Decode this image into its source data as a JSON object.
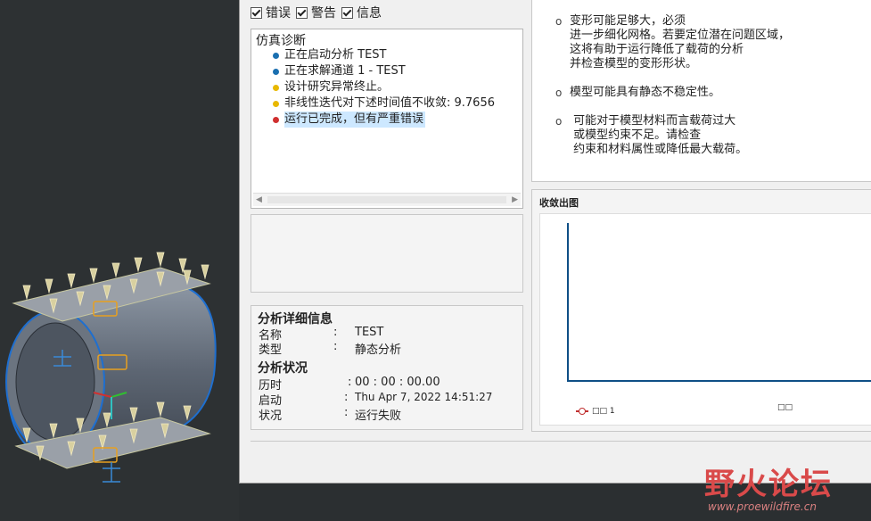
{
  "filters": [
    {
      "label": "错误",
      "checked": true
    },
    {
      "label": "警告",
      "checked": true
    },
    {
      "label": "信息",
      "checked": true
    }
  ],
  "diagnostics": {
    "title": "仿真诊断",
    "items": [
      {
        "level": "info",
        "text": "正在启动分析 TEST"
      },
      {
        "level": "info",
        "text": "正在求解通道 1 - TEST"
      },
      {
        "level": "warning",
        "text": "设计研究异常终止。"
      },
      {
        "level": "warning",
        "text": "非线性迭代对下述时间值不收敛: 9.7656"
      },
      {
        "level": "error",
        "text": "运行已完成，但有严重错误",
        "selected": true
      }
    ]
  },
  "message": {
    "items": [
      {
        "text": "变形可能足够大，必须\n进一步细化网格。若要定位潜在问题区域，\n这将有助于运行降低了载荷的分析\n并检查模型的变形形状。"
      },
      {
        "text": "模型可能具有静态不稳定性。"
      },
      {
        "text": " 可能对于模型材料而言载荷过大\n 或模型约束不足。请检查\n 约束和材料属性或降低最大载荷。"
      }
    ],
    "bullet": "o"
  },
  "details": {
    "info_heading": "分析详细信息",
    "name_label": "名称",
    "name_value": "TEST",
    "type_label": "类型",
    "type_value": "静态分析",
    "status_heading": "分析状况",
    "elapsed_label": "历时",
    "elapsed_value": "00 : 00 : 00.00",
    "start_label": "启动",
    "start_value": "Thu Apr  7, 2022    14:51:27",
    "state_label": "状况",
    "state_value": "运行失败",
    "colon": ":"
  },
  "convergence": {
    "title": "收敛出图",
    "legend1": "□□ 1",
    "legend2": "□□"
  },
  "watermark": {
    "title": "野火论坛",
    "url": "www.proewildfire.cn"
  },
  "colors": {
    "info": "#1a6fb0",
    "warning": "#e8b800",
    "error": "#d03030",
    "axis": "#0f4f86"
  }
}
